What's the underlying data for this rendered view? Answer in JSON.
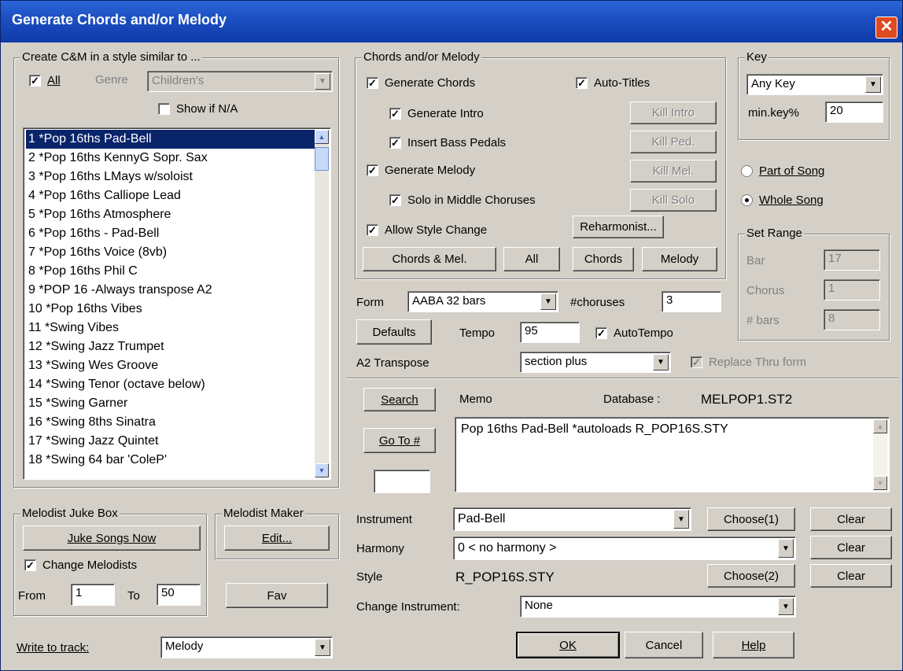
{
  "window": {
    "title": "Generate Chords and/or Melody",
    "close_label": "✕"
  },
  "style_group": {
    "label": "Create C&M in a style similar to ...",
    "all_label": "All",
    "all_checked": true,
    "genre_label": "Genre",
    "genre_value": "Children's",
    "show_na_label": "Show if N/A",
    "show_na_checked": false,
    "items": [
      "1 *Pop 16ths Pad-Bell",
      "2 *Pop 16ths KennyG Sopr. Sax",
      "3 *Pop 16ths LMays w/soloist",
      "4 *Pop 16ths Calliope Lead",
      "5 *Pop 16ths Atmosphere",
      "6 *Pop 16ths - Pad-Bell",
      "7 *Pop 16ths Voice (8vb)",
      "8 *Pop 16ths Phil C",
      "9 *POP 16 -Always transpose A2",
      "10 *Pop 16ths Vibes",
      "11 *Swing Vibes",
      "12 *Swing Jazz Trumpet",
      "13 *Swing Wes Groove",
      "14 *Swing Tenor (octave below)",
      "15 *Swing Garner",
      "16 *Swing 8ths Sinatra",
      "17 *Swing Jazz Quintet",
      "18 *Swing 64 bar 'ColeP'"
    ]
  },
  "chords_group": {
    "label": "Chords and/or Melody",
    "generate_chords": "Generate Chords",
    "auto_titles": "Auto-Titles",
    "generate_intro": "Generate Intro",
    "insert_bass": "Insert Bass Pedals",
    "generate_melody": "Generate Melody",
    "solo_middle": "Solo in Middle Choruses",
    "allow_style": "Allow Style Change",
    "kill_intro": "Kill Intro",
    "kill_ped": "Kill Ped.",
    "kill_mel": "Kill Mel.",
    "kill_solo": "Kill Solo",
    "reharmonist": "Reharmonist...",
    "chords_mel": "Chords & Mel.",
    "all": "All",
    "chords": "Chords",
    "melody": "Melody"
  },
  "key_group": {
    "label": "Key",
    "key_value": "Any Key",
    "minkey_label": "min.key%",
    "minkey_value": "20"
  },
  "part_of_song": "Part of Song",
  "whole_song": "Whole Song",
  "range_group": {
    "label": "Set Range",
    "bar_label": "Bar",
    "bar_value": "17",
    "chorus_label": "Chorus",
    "chorus_value": "1",
    "bars_label": "# bars",
    "bars_value": "8"
  },
  "form": {
    "form_label": "Form",
    "form_value": "AABA 32 bars",
    "choruses_label": "#choruses",
    "choruses_value": "3",
    "defaults": "Defaults",
    "tempo_label": "Tempo",
    "tempo_value": "95",
    "autotempo": "AutoTempo",
    "a2_label": "A2 Transpose",
    "a2_value": "section plus",
    "replace_thru": "Replace Thru form"
  },
  "database": {
    "search": "Search",
    "memo_label": "Memo",
    "database_label": "Database :",
    "database_value": "MELPOP1.ST2",
    "goto": "Go To #",
    "goto_value": "",
    "memo_text": "Pop 16ths Pad-Bell   *autoloads R_POP16S.STY"
  },
  "instrument": {
    "instrument_label": "Instrument",
    "instrument_value": "Pad-Bell",
    "choose1": "Choose(1)",
    "clear": "Clear",
    "harmony_label": "Harmony",
    "harmony_value": "0 < no harmony >",
    "style_label": "Style",
    "style_value": "R_POP16S.STY",
    "choose2": "Choose(2)",
    "change_label": "Change Instrument:",
    "change_value": "None"
  },
  "juke": {
    "label": "Melodist Juke Box",
    "juke_now": "Juke Songs Now",
    "change_melodists": "Change Melodists",
    "from_label": "From",
    "from_value": "1",
    "to_label": "To",
    "to_value": "50"
  },
  "maker": {
    "label": "Melodist Maker",
    "edit": "Edit...",
    "fav": "Fav"
  },
  "write_track": {
    "label": "Write to track:",
    "value": "Melody"
  },
  "footer": {
    "ok": "OK",
    "cancel": "Cancel",
    "help": "Help"
  }
}
